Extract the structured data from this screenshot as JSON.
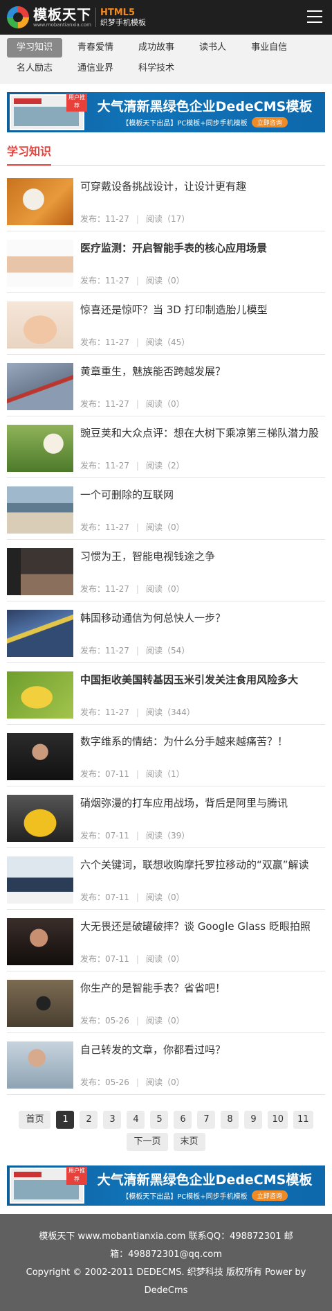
{
  "header": {
    "logo_text": "模板天下",
    "logo_url": "www.mobantianxia.com",
    "logo_html5": "HTML5",
    "logo_sub": "织梦手机模板",
    "menu_icon": "hamburger-menu-icon"
  },
  "nav": {
    "items": [
      {
        "label": "学习知识",
        "active": true
      },
      {
        "label": "青春爱情"
      },
      {
        "label": "成功故事"
      },
      {
        "label": "读书人"
      },
      {
        "label": "事业自信"
      },
      {
        "label": "名人励志"
      },
      {
        "label": "通信业界"
      },
      {
        "label": "科学技术"
      }
    ]
  },
  "banner": {
    "title": "大气清新黑绿色企业DedeCMS模板",
    "sub": "【模板天下出品】PC模板+同步手机模板",
    "button": "立即咨询",
    "badge": "用户推荐"
  },
  "section": {
    "title": "学习知识"
  },
  "meta_labels": {
    "published": "发布：",
    "read": "阅读（",
    "read_end": "）"
  },
  "articles": [
    {
      "title": "可穿戴设备挑战设计，让设计更有趣",
      "bold": false,
      "date": "11-27",
      "reads": "17",
      "thumb": "puppy"
    },
    {
      "title": "医疗监测：开启智能手表的核心应用场景",
      "bold": true,
      "date": "11-27",
      "reads": "0",
      "thumb": "watch"
    },
    {
      "title": "惊喜还是惊吓？当 3D 打印制造胎儿模型",
      "bold": false,
      "date": "11-27",
      "reads": "45",
      "thumb": "baby"
    },
    {
      "title": "黄章重生，魅族能否跨越发展？",
      "bold": false,
      "date": "11-27",
      "reads": "0",
      "thumb": "horse"
    },
    {
      "title": "豌豆荚和大众点评：想在大树下乘凉第三梯队潜力股",
      "bold": false,
      "date": "11-27",
      "reads": "2",
      "thumb": "grass"
    },
    {
      "title": "一个可删除的互联网",
      "bold": false,
      "date": "11-27",
      "reads": "0",
      "thumb": "beach"
    },
    {
      "title": "习惯为王，智能电视钱途之争",
      "bold": false,
      "date": "11-27",
      "reads": "0",
      "thumb": "room"
    },
    {
      "title": "韩国移动通信为何总快人一步？",
      "bold": false,
      "date": "11-27",
      "reads": "54",
      "thumb": "style"
    },
    {
      "title": "中国拒收美国转基因玉米引发关注食用风险多大",
      "bold": true,
      "date": "11-27",
      "reads": "344",
      "thumb": "corn"
    },
    {
      "title": "数字维系的情结：为什么分手越来越痛苦？！",
      "bold": false,
      "date": "07-11",
      "reads": "1",
      "thumb": "man"
    },
    {
      "title": "硝烟弥漫的打车应用战场，背后是阿里与腾讯",
      "bold": false,
      "date": "07-11",
      "reads": "39",
      "thumb": "car"
    },
    {
      "title": "六个关键词，联想收购摩托罗拉移动的“双赢”解读",
      "bold": false,
      "date": "07-11",
      "reads": "0",
      "thumb": "meeting"
    },
    {
      "title": "大无畏还是破罐破摔？谈 Google Glass 眨眼拍照",
      "bold": false,
      "date": "07-11",
      "reads": "0",
      "thumb": "glass"
    },
    {
      "title": "你生产的是智能手表？省省吧！",
      "bold": false,
      "date": "05-26",
      "reads": "0",
      "thumb": "wrist"
    },
    {
      "title": "自己转发的文章，你都看过吗？",
      "bold": false,
      "date": "05-26",
      "reads": "0",
      "thumb": "phone"
    }
  ],
  "pager": {
    "first": "首页",
    "pages": [
      "1",
      "2",
      "3",
      "4",
      "5",
      "6",
      "7",
      "8",
      "9",
      "10",
      "11"
    ],
    "current": "1",
    "next": "下一页",
    "last": "末页"
  },
  "footer": {
    "line1": "模板天下 www.mobantianxia.com 联系QQ：498872301 邮",
    "line2": "箱：498872301@qq.com",
    "line3": "Copyright © 2002-2011 DEDECMS. 织梦科技 版权所有 Power by DedeCms"
  },
  "colors": {
    "accent": "#e8413c",
    "header_bg": "#1f1f1f",
    "footer_bg": "#606060"
  }
}
